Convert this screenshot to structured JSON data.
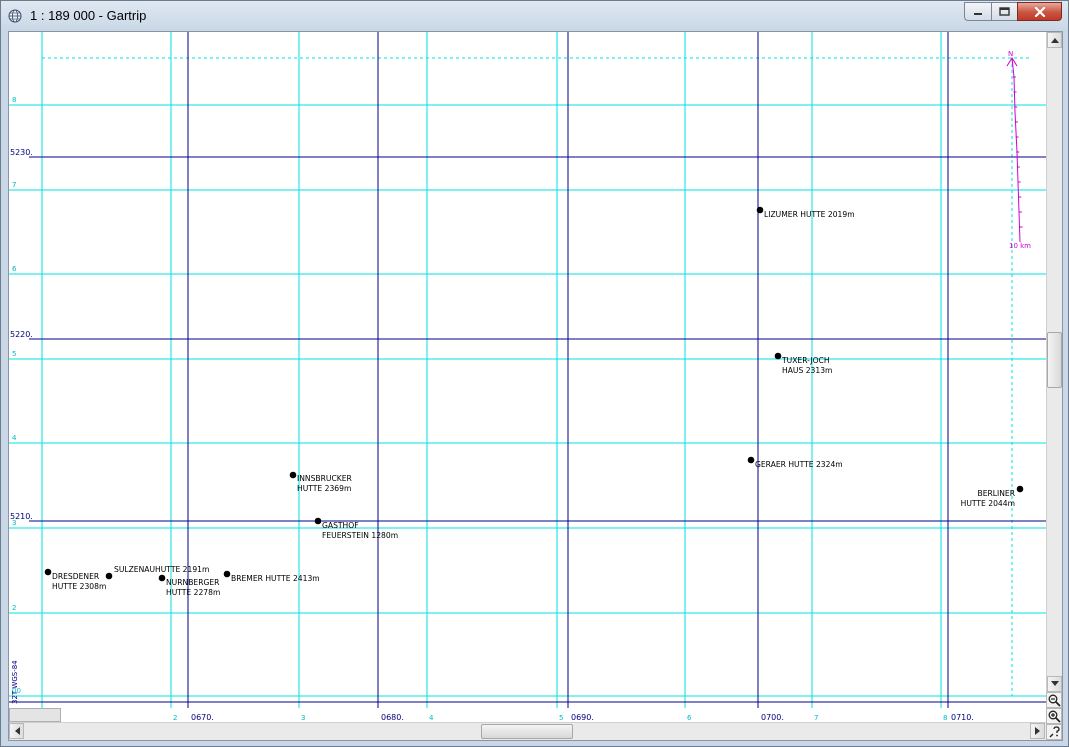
{
  "window": {
    "title": "1 : 189 000 - Gartrip"
  },
  "colors": {
    "minor_grid": "#00e0e0",
    "major_grid": "#00008b",
    "minor_label": "#00b8c8",
    "major_label": "#000080",
    "waypoint": "#000000",
    "north_arrow": "#d000d0"
  },
  "icons": {
    "app": "globe-icon",
    "minimize": "minimize-icon",
    "maximize": "maximize-icon",
    "close": "close-icon",
    "scroll_up": "arrow-up-icon",
    "scroll_down": "arrow-down-icon",
    "scroll_left": "arrow-left-icon",
    "scroll_right": "arrow-right-icon",
    "zoom_out": "zoom-out-icon",
    "zoom_in": "zoom-in-icon",
    "help": "help-icon"
  },
  "map": {
    "datum_label": "32T WGS-84",
    "north_arrow": {
      "north_label": "N",
      "scale_label": "10 km"
    },
    "easting_major": [
      "0670.",
      "0680.",
      "0690.",
      "0700.",
      "0710."
    ],
    "easting_minor": [
      "2",
      "3",
      "4",
      "5",
      "6",
      "7",
      "8"
    ],
    "northing_major": [
      "5230.",
      "5220.",
      "5210."
    ],
    "northing_minor": [
      "8",
      "7",
      "6",
      "5",
      "4",
      "3",
      "2",
      "00"
    ],
    "waypoints": [
      {
        "name": "lizumer",
        "lines": [
          "LIZUMER HUTTE 2019m"
        ]
      },
      {
        "name": "tuxer-joch",
        "lines": [
          "TUXER-JOCH",
          "HAUS 2313m"
        ]
      },
      {
        "name": "geraer",
        "lines": [
          "GERAER HUTTE 2324m"
        ]
      },
      {
        "name": "berliner",
        "lines": [
          "BERLINER",
          "HUTTE 2044m"
        ]
      },
      {
        "name": "innsbrucker",
        "lines": [
          "INNSBRUCKER",
          "HUTTE 2369m"
        ]
      },
      {
        "name": "gasthof",
        "lines": [
          "GASTHOF",
          "FEUERSTEIN 1280m"
        ]
      },
      {
        "name": "dresdener",
        "lines": [
          "DRESDENER",
          "HUTTE 2308m"
        ]
      },
      {
        "name": "sulzenau",
        "lines": [
          "SULZENAUHUTTE 2191m"
        ]
      },
      {
        "name": "nurnberger",
        "lines": [
          "NURNBERGER",
          "HUTTE 2278m"
        ]
      },
      {
        "name": "bremer",
        "lines": [
          "BREMER HUTTE 2413m"
        ]
      }
    ]
  }
}
